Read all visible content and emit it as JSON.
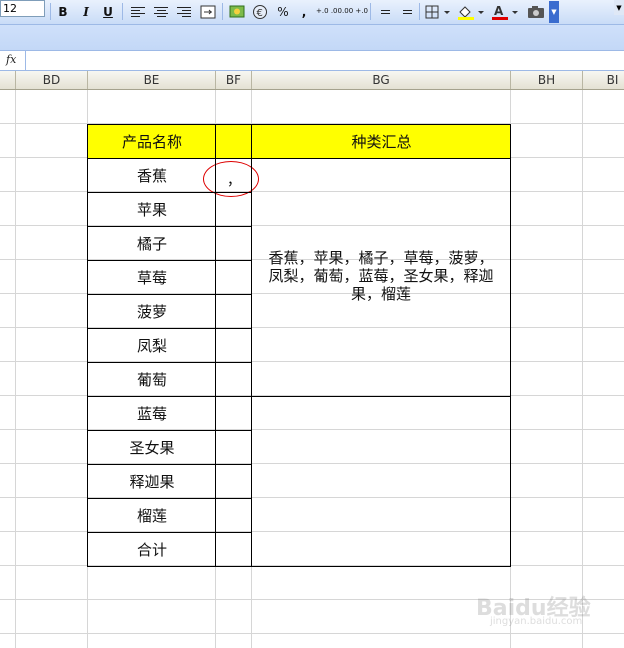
{
  "toolbar": {
    "font_size": "12",
    "bold": "B",
    "italic": "I",
    "underline": "U",
    "percent": "%",
    "comma": ",",
    "inc_decimal": "+.0 .00",
    "dec_decimal": ".00 +.0",
    "font_color_letter": "A"
  },
  "formula_bar": {
    "fx": "fx",
    "value": ""
  },
  "columns": [
    "BD",
    "BE",
    "BF",
    "BG",
    "BH",
    "BI"
  ],
  "table": {
    "header_name": "产品名称",
    "header_summary": "种类汇总",
    "items": [
      "香蕉",
      "苹果",
      "橘子",
      "草莓",
      "菠萝",
      "凤梨",
      "葡萄",
      "蓝莓",
      "圣女果",
      "释迦果",
      "榴莲",
      "合计"
    ],
    "bf_first": "，",
    "summary_lines": [
      "香蕉，苹果，橘子，草莓，菠萝，",
      "凤梨，葡萄，蓝莓，圣女果，释迦",
      "果，榴莲"
    ]
  },
  "annotation_color": "#dd0000",
  "header_fill": "#ffff00",
  "watermark": {
    "logo": "Baidu经验",
    "url": "jingyan.baidu.com"
  }
}
